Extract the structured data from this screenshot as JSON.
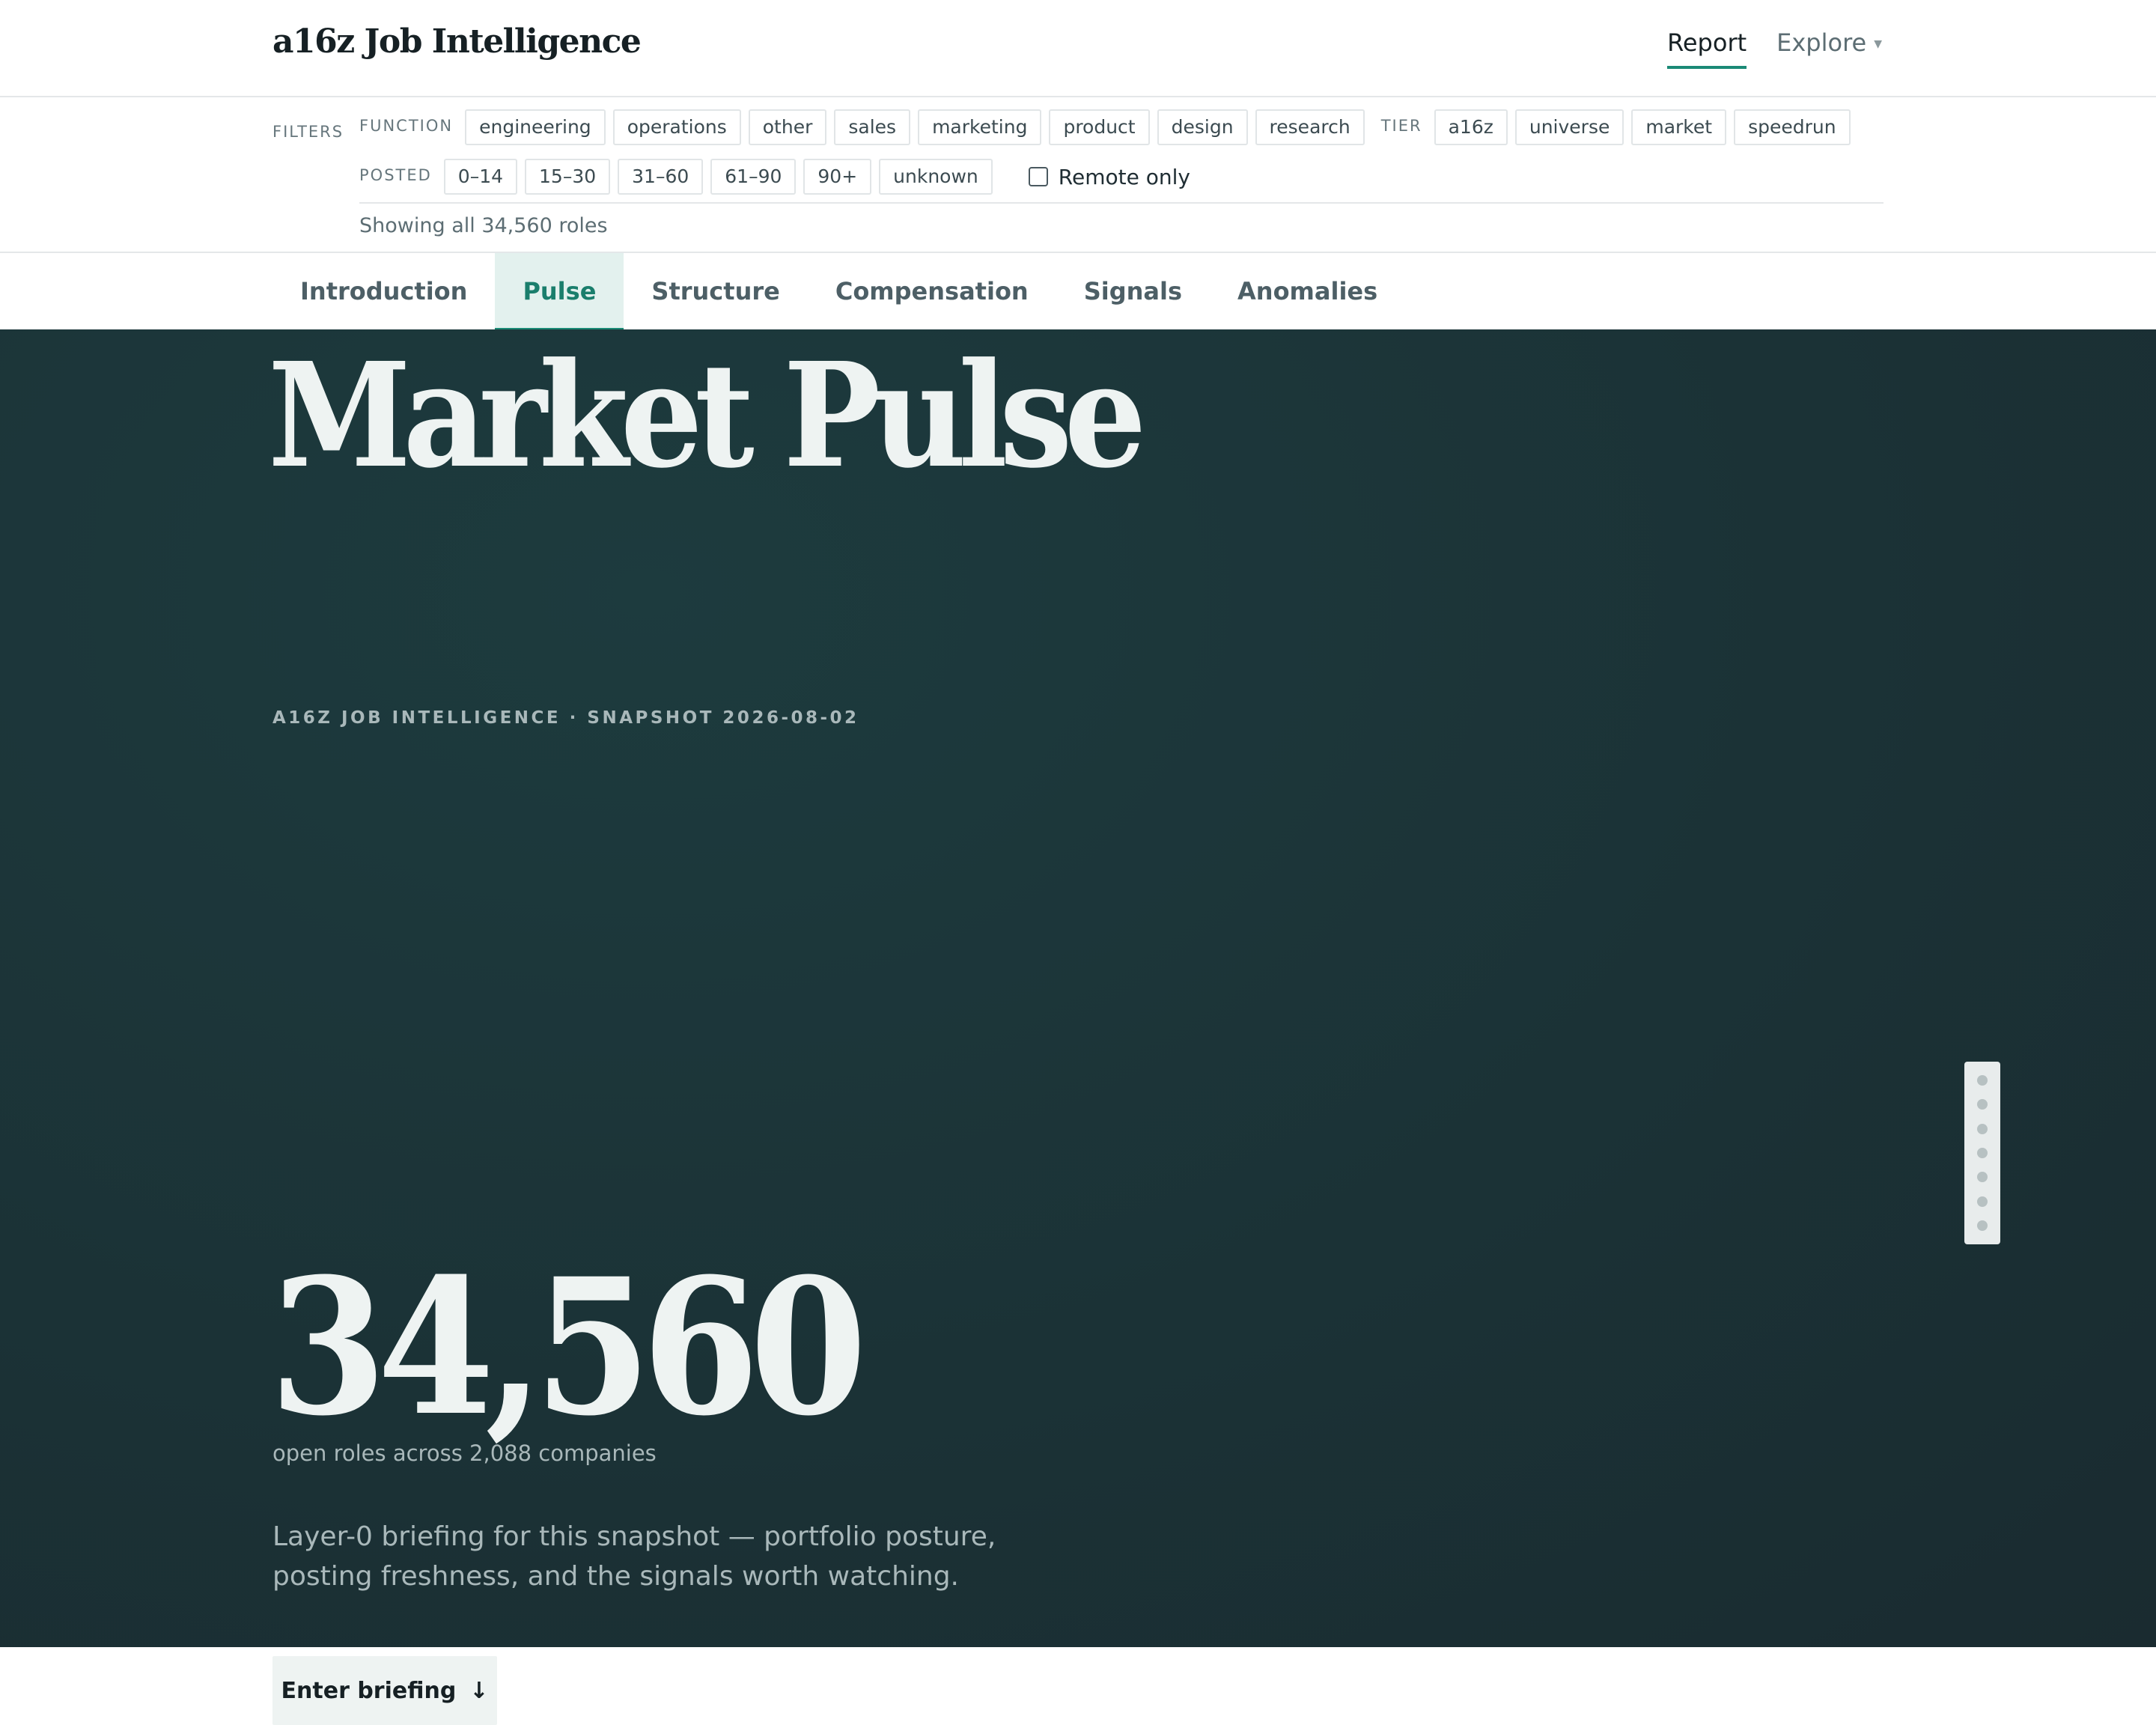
{
  "header": {
    "brand": "a16z Job Intelligence",
    "nav": [
      {
        "label": "Report",
        "active": true
      },
      {
        "label": "Explore",
        "has_dropdown": true
      }
    ]
  },
  "filters": {
    "label": "FILTERS",
    "function": {
      "label": "FUNCTION",
      "options": [
        "engineering",
        "operations",
        "other",
        "sales",
        "marketing",
        "product",
        "design",
        "research"
      ]
    },
    "tier": {
      "label": "TIER",
      "options": [
        "a16z",
        "universe",
        "market",
        "speedrun"
      ]
    },
    "posted": {
      "label": "POSTED",
      "options": [
        "0–14",
        "15–30",
        "31–60",
        "61–90",
        "90+",
        "unknown"
      ]
    },
    "remote_only": {
      "label": "Remote only",
      "checked": false
    },
    "showing": "Showing all 34,560 roles"
  },
  "tabs": [
    {
      "label": "Introduction",
      "active": false
    },
    {
      "label": "Pulse",
      "active": true
    },
    {
      "label": "Structure",
      "active": false
    },
    {
      "label": "Compensation",
      "active": false
    },
    {
      "label": "Signals",
      "active": false
    },
    {
      "label": "Anomalies",
      "active": false
    }
  ],
  "hero": {
    "eyebrow": "A16Z JOB INTELLIGENCE · SNAPSHOT 2026-08-02",
    "title": "Market Pulse",
    "big_number": "34,560",
    "number_caption": "open roles across 2,088 companies",
    "lede": "Layer-0 briefing for this snapshot — portfolio posture, posting freshness, and the signals worth watching.",
    "cta_label": "Enter briefing",
    "cta_icon": "↓"
  },
  "colors": {
    "accent": "#1a8a76",
    "hero_bg": "#1b3236",
    "active_tab_bg": "#e3f1ee"
  }
}
